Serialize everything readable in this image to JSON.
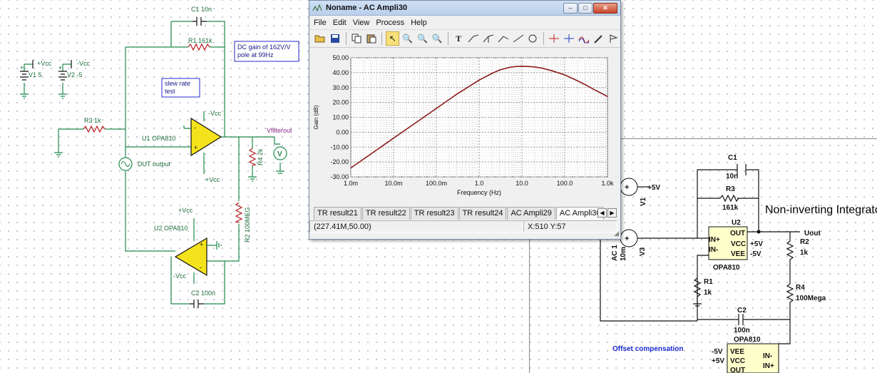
{
  "left_schematic": {
    "labels": {
      "c1": "C1 10n",
      "r1": "R1 161k",
      "note_dc": [
        "DC gain of 162V/V",
        "pole at 99Hz"
      ],
      "note_slew": [
        "slew rate",
        "test"
      ],
      "v1": "V1 5",
      "v1_net": "+Vcc",
      "v2": "V2 -5",
      "v2_net": "-Vcc",
      "r3": "R3 1k",
      "u1": "U1 OPA810",
      "u1_top": "-Vcc",
      "u1_bottom": "+Vcc",
      "vfilterout": "Vfilterout",
      "r4": "R4 2k",
      "dut": "DUT output",
      "r2": "R2 100MEG",
      "u2": "U2 OPA810",
      "u2_top": "+Vcc",
      "u2_bottom": "-Vcc",
      "c2": "C2 100n",
      "plus": "+",
      "minus": "-"
    }
  },
  "right_schematic": {
    "labels": {
      "c1": "C1",
      "c1_val": "10n",
      "r3": "R3",
      "r3_val": "161k",
      "v1": "V1",
      "v1_net": "+5V",
      "title_integrator": "Non-inverting Integrator",
      "u2": "U2",
      "u2_out": "OUT",
      "u2_inp": "IN+",
      "u2_inn": "IN-",
      "u2_vcc": "VCC",
      "u2_vee": "VEE",
      "u2_vcc_net": "+5V",
      "u2_vee_net": "-5V",
      "u2_part": "OPA810",
      "uout": "Uout",
      "r2": "R2",
      "r2_val": "1k",
      "ac1": "AC 1",
      "ac1_val": "10m",
      "v3": "V3",
      "r1": "R1",
      "r1_val": "1k",
      "r4": "R4",
      "r4_val": "100Mega",
      "c2": "C2",
      "c2_val": "100n",
      "u3_part": "OPA810",
      "title_offset": "Offset compensation",
      "u3_vee_net": "-5V",
      "u3_vcc_net": "+5V",
      "u3_vee": "VEE",
      "u3_vcc": "VCC",
      "u3_out": "OUT",
      "u3_inn": "IN-",
      "u3_inp": "IN+"
    }
  },
  "window": {
    "title": "Noname - AC Ampli30",
    "buttons": {
      "minimize": "–",
      "maximize": "□",
      "close": "✕"
    },
    "menu": [
      "File",
      "Edit",
      "View",
      "Process",
      "Help"
    ],
    "toolbar_icons": [
      "open-icon",
      "save-icon",
      "copy-icon",
      "paste-icon",
      "pointer-icon",
      "zoom-in-icon",
      "zoom-out-icon",
      "zoom-100-icon",
      "text-icon",
      "cursor-a-icon",
      "cursor-b-icon",
      "cursor-c-icon",
      "line-icon",
      "circle-icon",
      "marker-a-icon",
      "marker-b-icon",
      "series-icon",
      "probe-icon",
      "flag-icon"
    ],
    "tabs": [
      "TR result21",
      "TR result22",
      "TR result23",
      "TR result24",
      "AC Ampli29",
      "AC Ampli30"
    ],
    "active_tab": "AC Ampli30",
    "status_left": "(227.41M,50.00)",
    "status_right": "X:510  Y:57"
  },
  "chart_data": {
    "type": "line",
    "xlabel": "Frequency (Hz)",
    "ylabel": "Gain (dB)",
    "x_scale": "log",
    "xlim": [
      0.001,
      1000
    ],
    "ylim": [
      -30,
      50
    ],
    "x_tick_labels": [
      "1.0m",
      "10.0m",
      "100.0m",
      "1.0",
      "10.0",
      "100.0",
      "1.0k"
    ],
    "y_tick_labels": [
      "50.00",
      "40.00",
      "30.00",
      "20.00",
      "10.00",
      "0.00",
      "-10.00",
      "-20.00",
      "-30.00"
    ],
    "grid": true,
    "line_color": "#8b1a1a",
    "series": [
      {
        "x": [
          0.001,
          0.003,
          0.01,
          0.03,
          0.1,
          0.3,
          1,
          2,
          3,
          5,
          7,
          10,
          15,
          20,
          30,
          50,
          100,
          200,
          300,
          500,
          1000
        ],
        "y": [
          -24,
          -14.5,
          -4,
          5.5,
          16,
          25.5,
          35,
          39.5,
          41.8,
          43.5,
          44.1,
          44.3,
          44.1,
          43.8,
          43,
          41.3,
          38.5,
          34.5,
          32,
          28.5,
          24
        ]
      }
    ]
  }
}
